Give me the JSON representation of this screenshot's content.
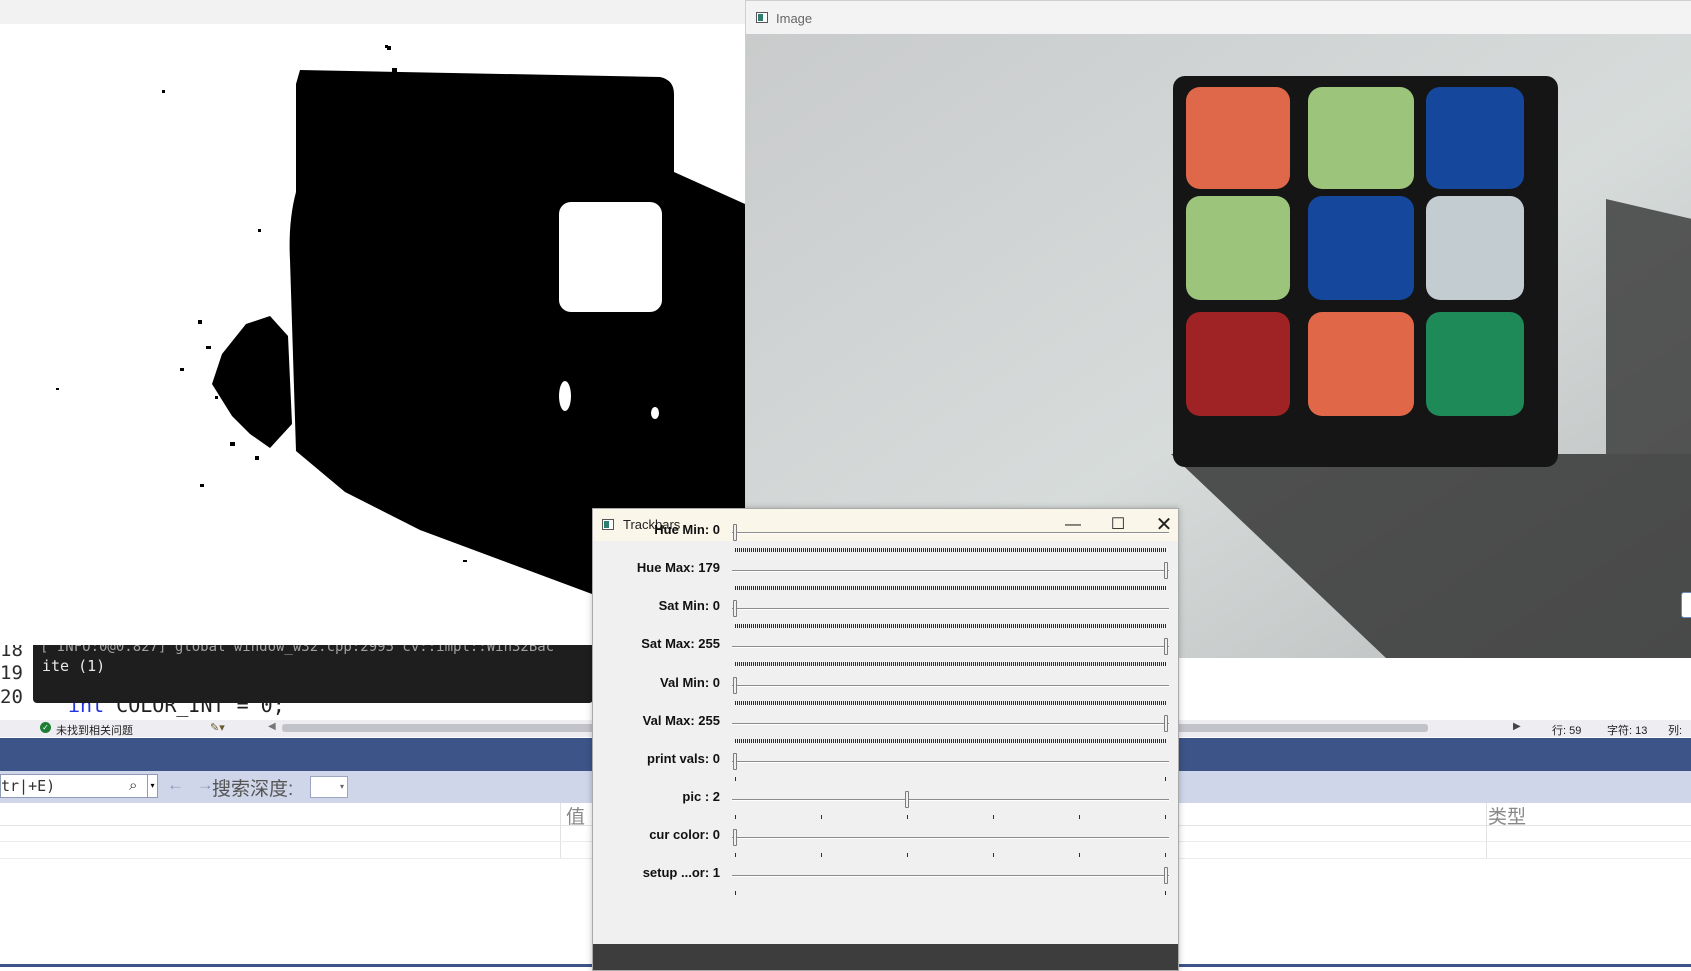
{
  "ide": {
    "line_numbers": [
      "18",
      "19",
      "20"
    ],
    "code_line": {
      "keyword": "int",
      "rest": " COLOR_INT = 0;"
    },
    "console": {
      "line1": "[ INFO:0@0.827] global window_w32.cpp:2995 cv::impl::Win32Bac",
      "line2": "ite (1)"
    },
    "status": {
      "problems_text": "未找到相关问题",
      "row": "行: 59",
      "char": "字符: 13",
      "col": "列:"
    },
    "watch": {
      "search_placeholder": "tr|+E)",
      "search_depth_label": "搜索深度:",
      "nav_arrows": "← →",
      "col_value": "值",
      "col_type": "类型"
    }
  },
  "image_window": {
    "title": "Image",
    "cube_colors": [
      [
        "#e0684a",
        "#9cc47a",
        "#15479c"
      ],
      [
        "#9cc47a",
        "#15479c",
        "#c3cdd1"
      ],
      [
        "#9f2325",
        "#e06848",
        "#1d8a58"
      ]
    ]
  },
  "trackbars_window": {
    "title": "Trackbars",
    "controls": [
      "—",
      "☐",
      "✕"
    ],
    "trackbars": [
      {
        "label": "Hue Min: 0",
        "value": 0,
        "max": 179
      },
      {
        "label": "Hue Max: 179",
        "value": 179,
        "max": 179
      },
      {
        "label": "Sat Min: 0",
        "value": 0,
        "max": 255
      },
      {
        "label": "Sat Max: 255",
        "value": 255,
        "max": 255
      },
      {
        "label": "Val Min: 0",
        "value": 0,
        "max": 255
      },
      {
        "label": "Val Max: 255",
        "value": 255,
        "max": 255
      },
      {
        "label": "print vals: 0",
        "value": 0,
        "max": 1
      },
      {
        "label": "pic : 2",
        "value": 2,
        "max": 5
      },
      {
        "label": "cur color: 0",
        "value": 0,
        "max": 5
      },
      {
        "label": "setup ...or: 1",
        "value": 1,
        "max": 1
      }
    ]
  },
  "colors": {
    "ide_blue": "#3c5488",
    "search_row": "#cfd6ea",
    "titlebar_active": "#fbf6ea"
  }
}
